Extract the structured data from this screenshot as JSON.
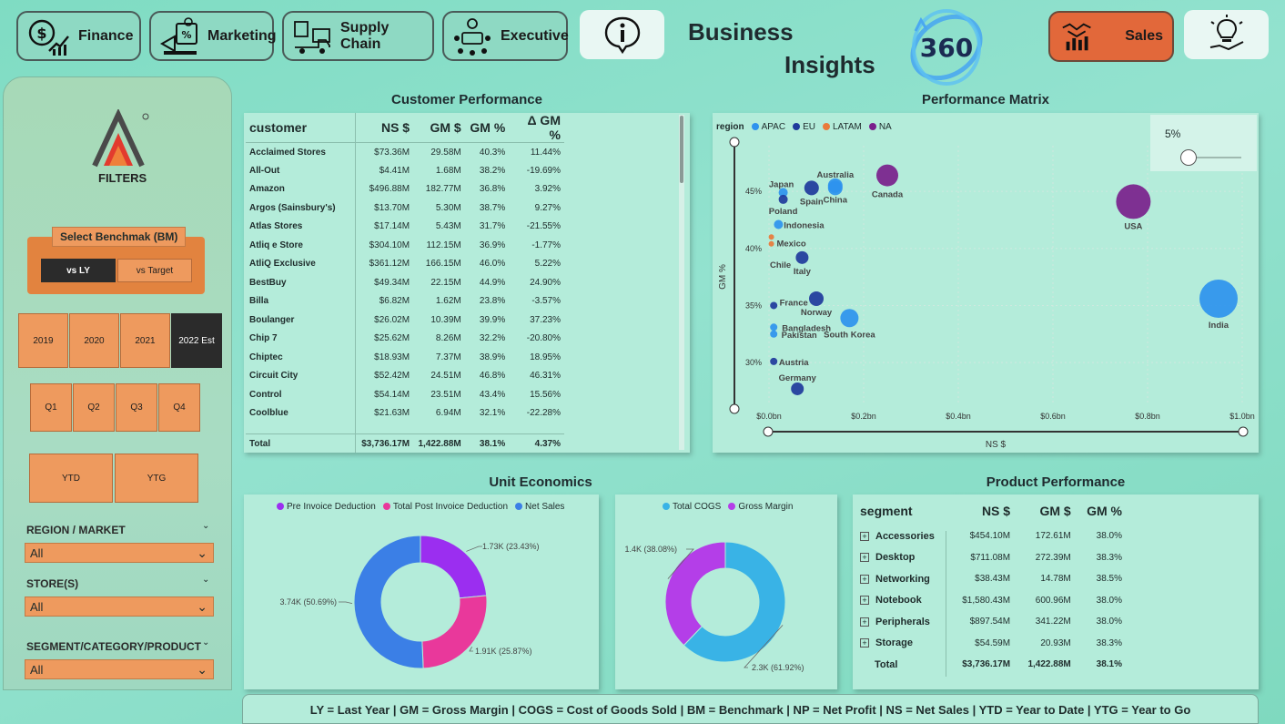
{
  "nav": {
    "finance": "Finance",
    "marketing": "Marketing",
    "supply_chain": "Supply Chain",
    "executive": "Executive",
    "sales": "Sales"
  },
  "header": {
    "title_line1": "Business",
    "title_line2": "Insights",
    "logo_text": "360"
  },
  "colors": {
    "accent_orange": "#ee9a5e",
    "sales_orange": "#e2683a",
    "panel_green": "#b4ecda",
    "dark": "#2b2b2b"
  },
  "sidebar": {
    "filters_label": "FILTERS",
    "benchmark_title": "Select Benchmak (BM)",
    "benchmark_options": [
      "vs LY",
      "vs Target"
    ],
    "benchmark_selected": "vs LY",
    "years": [
      "2019",
      "2020",
      "2021",
      "2022 Est"
    ],
    "year_selected": "2022 Est",
    "quarters": [
      "Q1",
      "Q2",
      "Q3",
      "Q4"
    ],
    "periods": [
      "YTD",
      "YTG"
    ],
    "region_label": "REGION / MARKET",
    "region_value": "All",
    "store_label": "STORE(S)",
    "store_value": "All",
    "segment_label": "SEGMENT/CATEGORY/PRODUCT",
    "segment_value": "All"
  },
  "customer_performance": {
    "title": "Customer Performance",
    "columns": [
      "customer",
      "NS $",
      "GM $",
      "GM %",
      "Δ GM %"
    ],
    "rows": [
      [
        "Acclaimed Stores",
        "$73.36M",
        "29.58M",
        "40.3%",
        "11.44%"
      ],
      [
        "All-Out",
        "$4.41M",
        "1.68M",
        "38.2%",
        "-19.69%"
      ],
      [
        "Amazon",
        "$496.88M",
        "182.77M",
        "36.8%",
        "3.92%"
      ],
      [
        "Argos (Sainsbury's)",
        "$13.70M",
        "5.30M",
        "38.7%",
        "9.27%"
      ],
      [
        "Atlas Stores",
        "$17.14M",
        "5.43M",
        "31.7%",
        "-21.55%"
      ],
      [
        "Atliq e Store",
        "$304.10M",
        "112.15M",
        "36.9%",
        "-1.77%"
      ],
      [
        "AtliQ Exclusive",
        "$361.12M",
        "166.15M",
        "46.0%",
        "5.22%"
      ],
      [
        "BestBuy",
        "$49.34M",
        "22.15M",
        "44.9%",
        "24.90%"
      ],
      [
        "Billa",
        "$6.82M",
        "1.62M",
        "23.8%",
        "-3.57%"
      ],
      [
        "Boulanger",
        "$26.02M",
        "10.39M",
        "39.9%",
        "37.23%"
      ],
      [
        "Chip 7",
        "$25.62M",
        "8.26M",
        "32.2%",
        "-20.80%"
      ],
      [
        "Chiptec",
        "$18.93M",
        "7.37M",
        "38.9%",
        "18.95%"
      ],
      [
        "Circuit City",
        "$52.42M",
        "24.51M",
        "46.8%",
        "46.31%"
      ],
      [
        "Control",
        "$54.14M",
        "23.51M",
        "43.4%",
        "15.56%"
      ],
      [
        "Coolblue",
        "$21.63M",
        "6.94M",
        "32.1%",
        "-22.28%"
      ]
    ],
    "total": [
      "Total",
      "$3,736.17M",
      "1,422.88M",
      "38.1%",
      "4.37%"
    ]
  },
  "performance_matrix": {
    "title": "Performance Matrix",
    "legend_title": "region",
    "slider_value": "5%",
    "chart_data": {
      "type": "scatter",
      "xlabel": "NS $",
      "ylabel": "GM %",
      "x_ticks": [
        "$0.0bn",
        "$0.2bn",
        "$0.4bn",
        "$0.6bn",
        "$0.8bn",
        "$1.0bn"
      ],
      "y_ticks": [
        "45%",
        "40%",
        "35%",
        "30%"
      ],
      "xlim": [
        0,
        1.0
      ],
      "ylim": [
        26.5,
        49
      ],
      "series": [
        {
          "name": "APAC",
          "color": "#2e93ee",
          "points": [
            {
              "label": "Australia",
              "x": 0.14,
              "y": 45.5,
              "r": 8
            },
            {
              "label": "China",
              "x": 0.14,
              "y": 45.3,
              "r": 8
            },
            {
              "label": "Japan",
              "x": 0.03,
              "y": 44.9,
              "r": 5
            },
            {
              "label": "Indonesia",
              "x": 0.02,
              "y": 42.1,
              "r": 5
            },
            {
              "label": "South Korea",
              "x": 0.17,
              "y": 33.9,
              "r": 10
            },
            {
              "label": "Bangladesh",
              "x": 0.01,
              "y": 33.1,
              "r": 4
            },
            {
              "label": "Pakistan",
              "x": 0.01,
              "y": 32.5,
              "r": 4
            },
            {
              "label": "India",
              "x": 0.95,
              "y": 35.6,
              "r": 21
            }
          ]
        },
        {
          "name": "EU",
          "color": "#1f3a9c",
          "points": [
            {
              "label": "Spain",
              "x": 0.09,
              "y": 45.3,
              "r": 8
            },
            {
              "label": "Poland",
              "x": 0.03,
              "y": 44.3,
              "r": 5
            },
            {
              "label": "Italy",
              "x": 0.07,
              "y": 39.2,
              "r": 7
            },
            {
              "label": "France",
              "x": 0.01,
              "y": 35.0,
              "r": 4
            },
            {
              "label": "Norway",
              "x": 0.1,
              "y": 35.6,
              "r": 8
            },
            {
              "label": "Austria",
              "x": 0.01,
              "y": 30.1,
              "r": 4
            },
            {
              "label": "Germany",
              "x": 0.06,
              "y": 27.7,
              "r": 7
            }
          ]
        },
        {
          "name": "LATAM",
          "color": "#e97a3a",
          "points": [
            {
              "label": "Mexico",
              "x": 0.005,
              "y": 41.0,
              "r": 3
            },
            {
              "label": "Chile",
              "x": 0.005,
              "y": 40.4,
              "r": 3
            }
          ]
        },
        {
          "name": "NA",
          "color": "#7a1f8c",
          "points": [
            {
              "label": "Canada",
              "x": 0.25,
              "y": 46.4,
              "r": 12
            },
            {
              "label": "USA",
              "x": 0.77,
              "y": 44.1,
              "r": 19
            }
          ]
        }
      ]
    }
  },
  "unit_economics": {
    "title": "Unit Economics",
    "chart_data": [
      {
        "type": "pie",
        "legend": [
          "Pre Invoice Deduction",
          "Total Post Invoice Deduction",
          "Net Sales"
        ],
        "values": [
          1.73,
          1.91,
          3.74
        ],
        "labels": [
          "1.73K (23.43%)",
          "1.91K (25.87%)",
          "3.74K (50.69%)"
        ],
        "colors": [
          "#9b2ef0",
          "#e9389b",
          "#3b7fe6"
        ]
      },
      {
        "type": "pie",
        "legend": [
          "Total COGS",
          "Gross Margin"
        ],
        "values": [
          2.3,
          1.4
        ],
        "labels": [
          "2.3K (61.92%)",
          "1.4K (38.08%)"
        ],
        "colors": [
          "#39b3e6",
          "#b43ee8"
        ]
      }
    ]
  },
  "product_performance": {
    "title": "Product Performance",
    "columns": [
      "segment",
      "NS $",
      "GM $",
      "GM %"
    ],
    "rows": [
      [
        "Accessories",
        "$454.10M",
        "172.61M",
        "38.0%"
      ],
      [
        "Desktop",
        "$711.08M",
        "272.39M",
        "38.3%"
      ],
      [
        "Networking",
        "$38.43M",
        "14.78M",
        "38.5%"
      ],
      [
        "Notebook",
        "$1,580.43M",
        "600.96M",
        "38.0%"
      ],
      [
        "Peripherals",
        "$897.54M",
        "341.22M",
        "38.0%"
      ],
      [
        "Storage",
        "$54.59M",
        "20.93M",
        "38.3%"
      ]
    ],
    "total": [
      "Total",
      "$3,736.17M",
      "1,422.88M",
      "38.1%"
    ]
  },
  "footer_text": "LY = Last Year | GM = Gross Margin | COGS = Cost of Goods Sold | BM = Benchmark | NP = Net Profit | NS = Net Sales | YTD = Year to Date | YTG = Year to Go"
}
